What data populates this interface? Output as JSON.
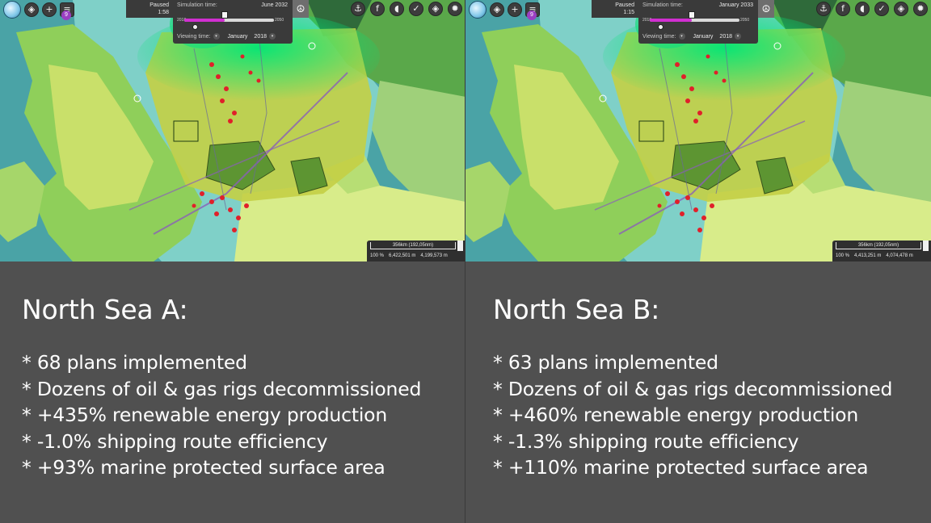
{
  "scenarios": [
    {
      "paused_label": "Paused",
      "clock": "1:58",
      "notification_count": "9",
      "simulation": {
        "time_label": "Simulation time:",
        "time_value": "June 2032",
        "start_year": "2018",
        "end_year": "2050",
        "progress": 0.45,
        "viewing_label": "Viewing time:",
        "viewing_month": "January",
        "viewing_year": "2018"
      },
      "scale": {
        "distance": "356km (192,05nm)",
        "zoom": "100 %",
        "coord_x": "6,422,501 m",
        "coord_y": "4,199,573 m"
      },
      "title": "North Sea A:",
      "bullets": [
        "* 68 plans implemented",
        "* Dozens of oil & gas rigs decommissioned",
        "* +435% renewable energy production",
        "* -1.0% shipping route efficiency",
        "* +93% marine protected surface area"
      ]
    },
    {
      "paused_label": "Paused",
      "clock": "1:15",
      "notification_count": "9",
      "simulation": {
        "time_label": "Simulation time:",
        "time_value": "January 2033",
        "start_year": "2018",
        "end_year": "2050",
        "progress": 0.47,
        "viewing_label": "Viewing time:",
        "viewing_month": "January",
        "viewing_year": "2018"
      },
      "scale": {
        "distance": "356km (192,05nm)",
        "zoom": "100 %",
        "coord_x": "4,413,251 m",
        "coord_y": "4,074,478 m"
      },
      "title": "North Sea B:",
      "bullets": [
        "* 63 plans implemented",
        "* Dozens of oil & gas rigs decommissioned",
        "* +460% renewable energy production",
        "* -1.3% shipping route efficiency",
        "* +110% marine protected surface area"
      ]
    }
  ],
  "icons": {
    "toolbar_left": [
      "logo-icon",
      "layers-icon",
      "plus-icon",
      "notes-icon"
    ],
    "toolbar_right": [
      "ship-icon",
      "energy-icon",
      "fish-icon",
      "check-icon",
      "layers-icon",
      "gear-icon"
    ],
    "peace": "peace-icon"
  },
  "colors": {
    "panel_bg": "#505050",
    "toolbar_bg": "#3a3a3a",
    "timeline_fill": "#d12fd1",
    "heatmap_green": "#00e676",
    "map_sea": "#4aa3a6",
    "map_land": "#c9e06a"
  }
}
